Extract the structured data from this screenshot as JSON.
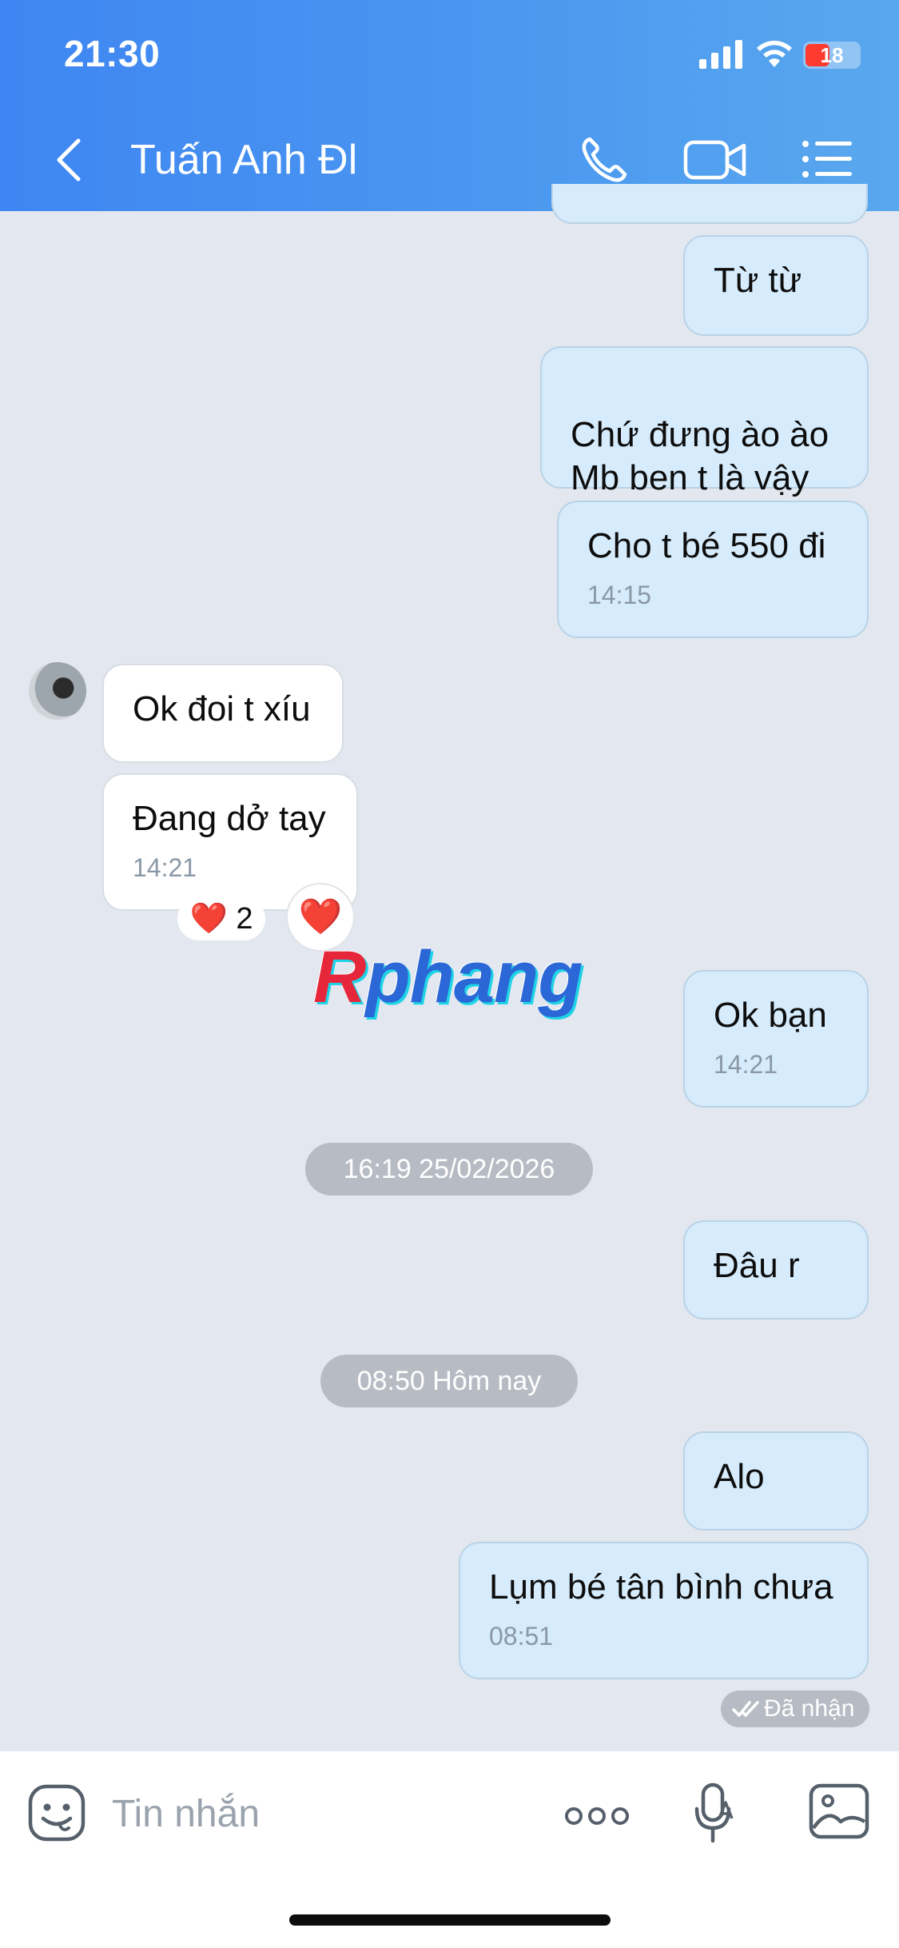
{
  "status_bar": {
    "time": "21:30",
    "battery": "18"
  },
  "header": {
    "contact_name": "Tuấn Anh Đl"
  },
  "messages": [
    {
      "direction": "out",
      "text": "Từ từ"
    },
    {
      "direction": "out",
      "text": "Chứ đưng ào ào\nMb ben t là vậy"
    },
    {
      "direction": "out",
      "text": "Cho t bé 550 đi",
      "time": "14:15"
    },
    {
      "direction": "in",
      "text": "Ok đoi t xíu"
    },
    {
      "direction": "in",
      "text": "Đang dở tay",
      "time": "14:21",
      "reaction": {
        "emoji": "❤️",
        "count": "2"
      }
    },
    {
      "direction": "out",
      "text": "Ok bạn",
      "time": "14:21"
    },
    {
      "direction": "out",
      "text": "Đâu r"
    },
    {
      "direction": "out",
      "text": "Alo"
    },
    {
      "direction": "out",
      "text": "Lụm bé tân bình chưa",
      "time": "08:51"
    }
  ],
  "separators": [
    "16:19 25/02/2026",
    "08:50 Hôm nay"
  ],
  "reaction_button": "❤️",
  "watermark": {
    "first": "R",
    "rest": "phang"
  },
  "delivery_status": "Đã nhận",
  "input": {
    "placeholder": "Tin nhắn"
  },
  "icons": {
    "back": "chevron-left-icon",
    "call": "phone-icon",
    "video": "video-camera-icon",
    "menu": "list-icon",
    "emoji": "sticker-icon",
    "more": "more-icon",
    "mic": "microphone-icon",
    "image": "image-icon"
  },
  "colors": {
    "header_start": "#3f86f2",
    "header_end": "#59a8ee",
    "chat_bg": "#e3e7ef",
    "bubble_out": "#d6ebfb",
    "bubble_in": "#ffffff",
    "pill": "#b7bcc4",
    "heart": "#e8243b"
  }
}
